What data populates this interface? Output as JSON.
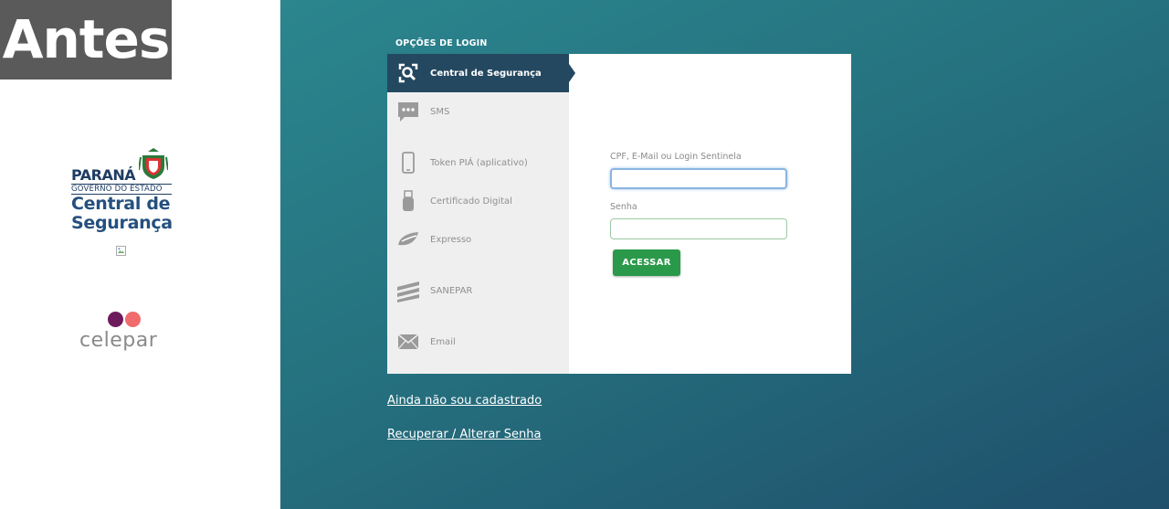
{
  "badge": {
    "label": "Antes"
  },
  "brand": {
    "parana_name": "PARANÁ",
    "parana_gov": "GOVERNO DO ESTADO",
    "app_line1": "Central de",
    "app_line2": "Segurança",
    "celepar": "celepar"
  },
  "login": {
    "section_title": "OPÇÕES DE LOGIN",
    "menu": [
      {
        "label": "Central de Segurança",
        "icon": "search-user-icon",
        "active": true
      },
      {
        "label": "SMS",
        "icon": "chat-icon"
      },
      {
        "label": "Token PIÁ (aplicativo)",
        "icon": "phone-icon"
      },
      {
        "label": "Certificado Digital",
        "icon": "usb-token-icon"
      },
      {
        "label": "Expresso",
        "icon": "expresso-icon"
      },
      {
        "label": "SANEPAR",
        "icon": "sanepar-icon"
      },
      {
        "label": "Email",
        "icon": "envelope-icon"
      }
    ],
    "form": {
      "user_label": "CPF, E-Mail ou Login Sentinela",
      "user_value": "",
      "password_label": "Senha",
      "password_value": "",
      "submit_label": "ACESSAR"
    }
  },
  "links": {
    "register": "Ainda não sou cadastrado",
    "recover": "Recuperar / Alterar Senha"
  },
  "colors": {
    "sidebar_active": "#244860",
    "submit": "#2a9a4a",
    "teal": "#2b868e"
  }
}
